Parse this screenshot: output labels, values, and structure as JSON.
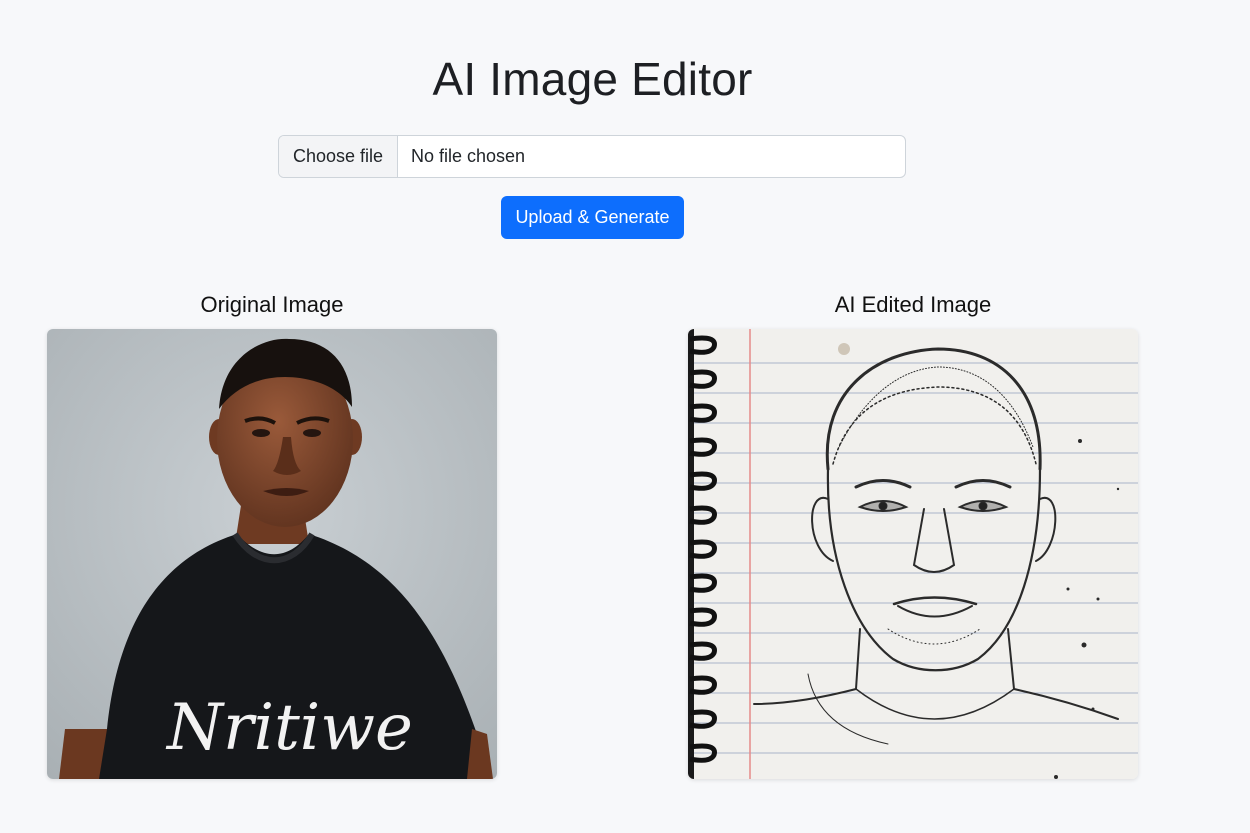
{
  "page": {
    "title": "AI Image Editor"
  },
  "upload": {
    "choose_label": "Choose file",
    "file_status": "No file chosen",
    "submit_label": "Upload & Generate"
  },
  "results": {
    "original_label": "Original Image",
    "edited_label": "AI Edited Image",
    "original_shirt_text": "Nritiwe"
  },
  "colors": {
    "primary": "#0d6efd",
    "background": "#f7f8fa"
  }
}
